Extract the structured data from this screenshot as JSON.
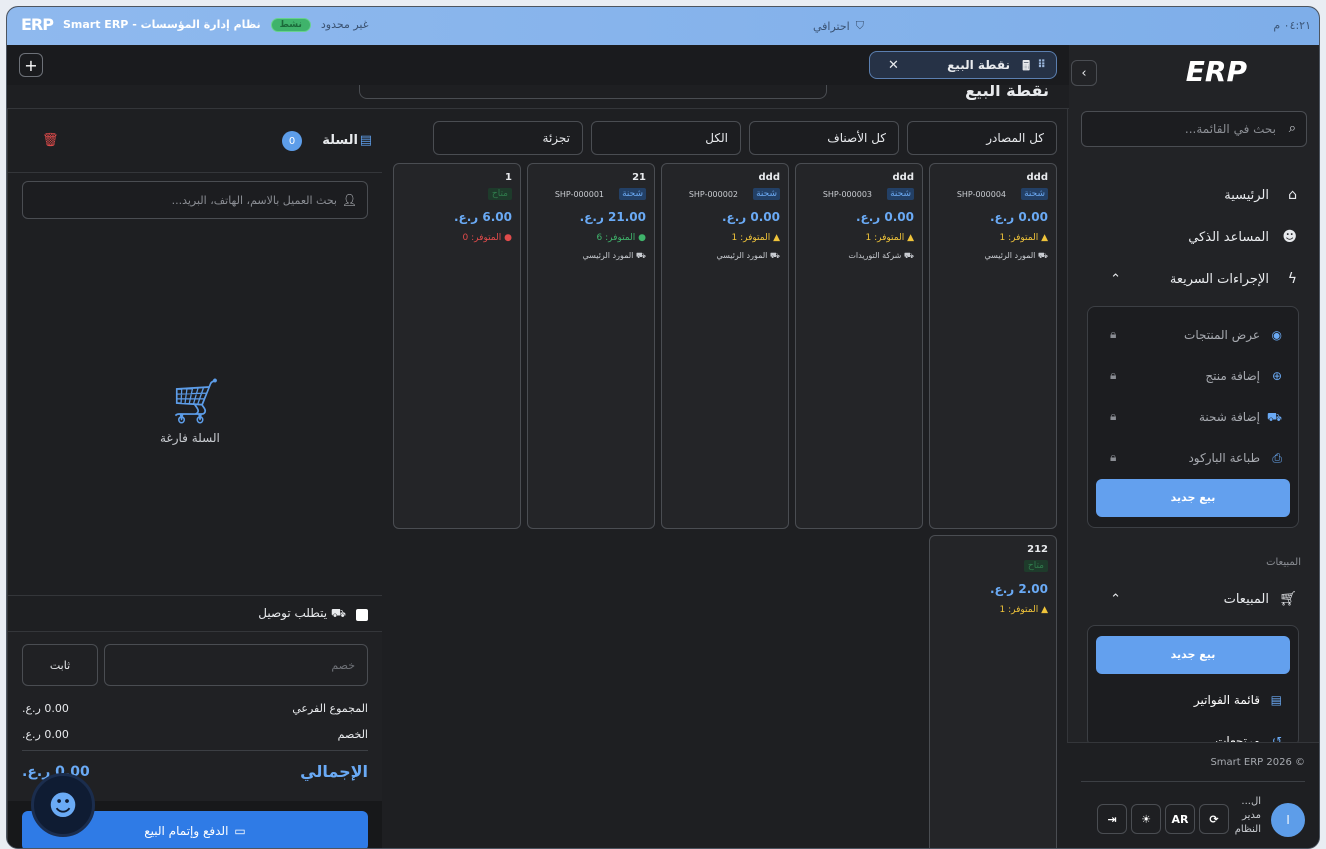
{
  "topbar": {
    "time": "٠٤:٢١ م",
    "profile": "احترافي",
    "app_name": "نظام إدارة المؤسسات - Smart ERP",
    "badge": "نشط",
    "unlimited": "غير محدود",
    "logo": "ERP"
  },
  "sidebar": {
    "logo": "ERP",
    "toggle": "›",
    "search_placeholder": "بحث في القائمة...",
    "nav": {
      "home": "الرئيسية",
      "assistant": "المساعد الذكي",
      "quick": "الإجراءات السريعة",
      "sales": "المبيعات"
    },
    "quick_items": [
      {
        "label": "عرض المنتجات",
        "icon": "eye-icon"
      },
      {
        "label": "إضافة منتج",
        "icon": "plus-circle-icon"
      },
      {
        "label": "إضافة شحنة",
        "icon": "truck-icon"
      },
      {
        "label": "طباعة الباركود",
        "icon": "printer-icon"
      }
    ],
    "quick_new_sale": "بيع جديد",
    "section_sales": "المبيعات",
    "sales_new": "بيع جديد",
    "sales_items": [
      {
        "label": "قائمة الفواتير",
        "icon": "document-icon"
      },
      {
        "label": "مرتجعات",
        "icon": "undo-icon"
      }
    ],
    "footer": {
      "copyright": "© Smart ERP 2026",
      "user_name": "ال...",
      "user_role": "مدير النظام",
      "avatar": "ا",
      "lang": "AR"
    }
  },
  "tabs": [
    {
      "label": "نقطة البيع"
    }
  ],
  "page": {
    "title": "نقطة البيع"
  },
  "filters": {
    "sources": "كل المصادر",
    "categories": "كل الأصناف",
    "all": "الكل",
    "retail": "تجزئة"
  },
  "products": [
    {
      "name": "ddd",
      "tag": "شحنة",
      "code": "SHP-000004",
      "price": "0.00 ر.ع.",
      "stock": "المتوفر: 1",
      "supplier": "المورد الرئيسي"
    },
    {
      "name": "ddd",
      "tag": "شحنة",
      "code": "SHP-000003",
      "price": "0.00 ر.ع.",
      "stock": "المتوفر: 1",
      "supplier": "شركة التوريدات"
    },
    {
      "name": "ddd",
      "tag": "شحنة",
      "code": "SHP-000002",
      "price": "0.00 ر.ع.",
      "stock": "المتوفر: 1",
      "supplier": "المورد الرئيسي"
    },
    {
      "name": "21",
      "tag": "شحنة",
      "code": "SHP-000001",
      "price": "21.00 ر.ع.",
      "stock": "المتوفر: 6",
      "supplier": "المورد الرئيسي"
    },
    {
      "name": "1",
      "tag": "متاح",
      "code": "",
      "price": "6.00 ر.ع.",
      "stock": "المتوفر: 0",
      "supplier": ""
    },
    {
      "name": "212",
      "tag": "متاح",
      "code": "",
      "price": "2.00 ر.ع.",
      "stock": "المتوفر: 1",
      "supplier": ""
    }
  ],
  "cart": {
    "title": "السلة",
    "count": "0",
    "customer_placeholder": "بحث العميل بالاسم، الهاتف، البريد...",
    "empty": "السلة فارغة",
    "delivery": "يتطلب توصيل",
    "discount_placeholder": "خصم",
    "discount_type": "ثابت",
    "subtotal_label": "المجموع الفرعي",
    "subtotal": "0.00 ر.ع.",
    "discount_label": "الخصم",
    "discount": "0.00 ر.ع.",
    "total_label": "الإجمالي",
    "total": "0.00 ر.ع.",
    "pay": "الدفع وإتمام البيع"
  },
  "colors": {
    "accent": "#5d9de9",
    "danger": "#e04b4b",
    "success": "#3fb36b",
    "warning": "#f0c43a"
  }
}
